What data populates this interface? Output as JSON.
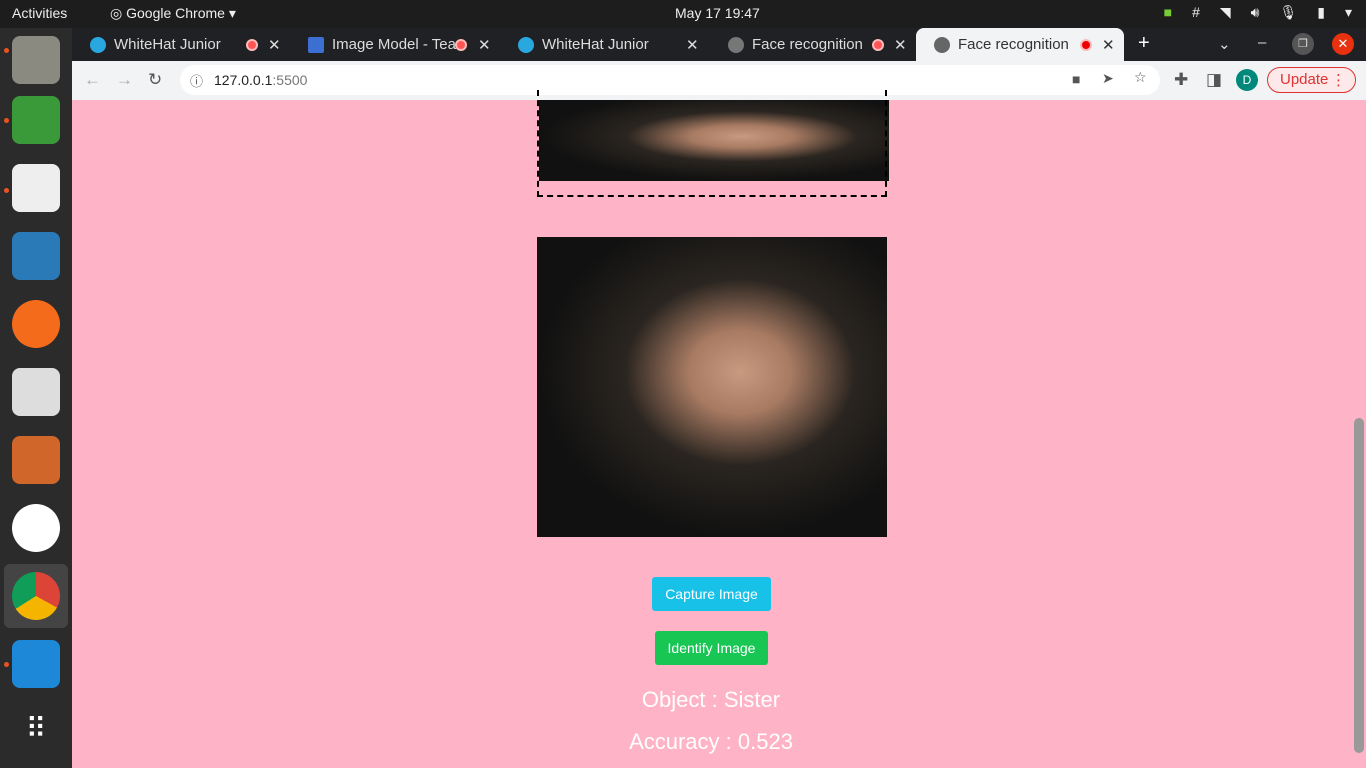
{
  "system": {
    "activities": "Activities",
    "app_name": "Google Chrome",
    "clock": "May 17  19:47"
  },
  "tabs": [
    {
      "title": "WhiteHat Junior",
      "recording": true
    },
    {
      "title": "Image Model - Tea",
      "recording": true
    },
    {
      "title": "WhiteHat Junior",
      "recording": false
    },
    {
      "title": "Face recognition",
      "recording": true
    },
    {
      "title": "Face recognition",
      "recording": true,
      "active": true
    }
  ],
  "address": {
    "host": "127.0.0.1",
    "port": ":5500"
  },
  "profile": {
    "initial": "D"
  },
  "update_label": "Update",
  "page": {
    "capture_label": "Capture Image",
    "identify_label": "Identify Image",
    "object_text": "Object : Sister",
    "accuracy_text": "Accuracy : 0.523"
  },
  "colors": {
    "background": "#ffb3c7",
    "capture": "#17c1e8",
    "identify": "#17c653"
  }
}
